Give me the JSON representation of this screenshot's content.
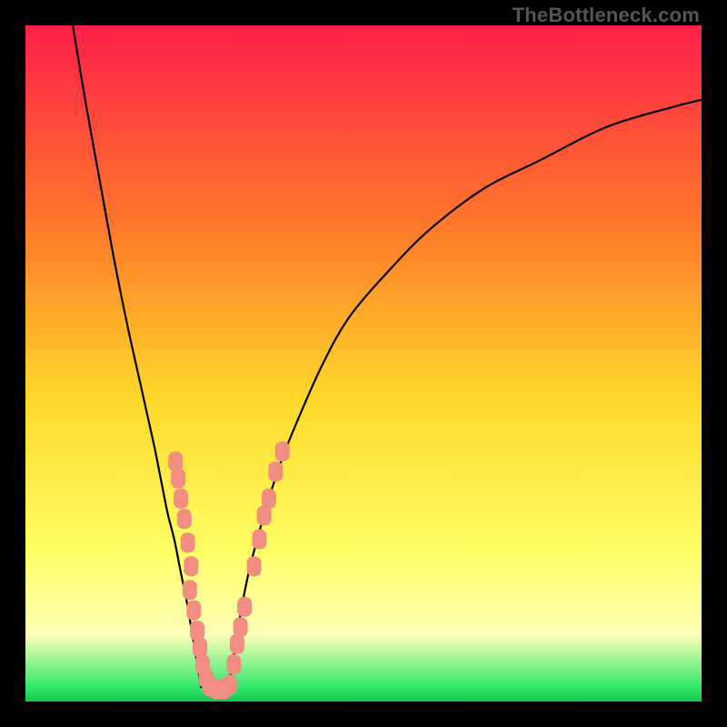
{
  "attribution": "TheBottleneck.com",
  "colors": {
    "frame": "#000000",
    "grad_top": "#ff1f49",
    "grad_mid1": "#ff7a2a",
    "grad_mid2": "#ffd72a",
    "grad_mid3": "#ffff66",
    "grad_pale": "#ffffb8",
    "grad_green": "#2fe76a",
    "curve": "#000000",
    "marker": "#f28d82"
  },
  "chart_data": {
    "type": "line",
    "title": "",
    "xlabel": "",
    "ylabel": "",
    "xlim": [
      0,
      100
    ],
    "ylim": [
      0,
      100
    ],
    "series": [
      {
        "name": "left-branch",
        "x": [
          7,
          9,
          11,
          13,
          15,
          17,
          19,
          20,
          21,
          22,
          23,
          24,
          25,
          26
        ],
        "y": [
          100,
          88,
          77,
          66,
          56,
          47,
          38,
          33,
          28,
          24,
          19,
          14,
          8,
          2
        ]
      },
      {
        "name": "right-branch",
        "x": [
          30,
          31,
          32,
          33,
          34,
          36,
          38,
          40,
          44,
          48,
          54,
          60,
          68,
          76,
          86,
          96,
          100
        ],
        "y": [
          2,
          8,
          14,
          19,
          23,
          30,
          36,
          41,
          50,
          57,
          64,
          70,
          76,
          80,
          85,
          88,
          89
        ]
      }
    ],
    "markers": [
      {
        "x": 22.2,
        "y": 35.5
      },
      {
        "x": 22.6,
        "y": 33.0
      },
      {
        "x": 23.0,
        "y": 30.0
      },
      {
        "x": 23.5,
        "y": 27.0
      },
      {
        "x": 24.0,
        "y": 23.5
      },
      {
        "x": 24.5,
        "y": 20.0
      },
      {
        "x": 24.3,
        "y": 16.5
      },
      {
        "x": 24.9,
        "y": 13.5
      },
      {
        "x": 25.4,
        "y": 10.5
      },
      {
        "x": 25.8,
        "y": 8.0
      },
      {
        "x": 26.2,
        "y": 5.5
      },
      {
        "x": 26.7,
        "y": 3.5
      },
      {
        "x": 27.3,
        "y": 2.2
      },
      {
        "x": 28.3,
        "y": 1.8
      },
      {
        "x": 29.3,
        "y": 1.8
      },
      {
        "x": 30.2,
        "y": 2.5
      },
      {
        "x": 30.8,
        "y": 5.5
      },
      {
        "x": 31.3,
        "y": 8.5
      },
      {
        "x": 31.8,
        "y": 11.0
      },
      {
        "x": 32.4,
        "y": 14.0
      },
      {
        "x": 33.8,
        "y": 20.0
      },
      {
        "x": 34.6,
        "y": 24.0
      },
      {
        "x": 35.3,
        "y": 27.5
      },
      {
        "x": 36.0,
        "y": 30.0
      },
      {
        "x": 37.0,
        "y": 34.0
      },
      {
        "x": 38.0,
        "y": 37.0
      }
    ]
  }
}
